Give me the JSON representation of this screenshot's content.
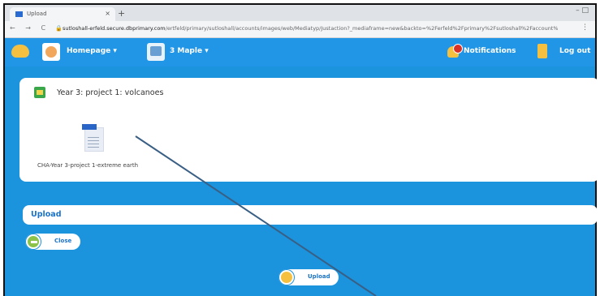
{
  "browser": {
    "tab_title": "Upload",
    "tab_close": "×",
    "new_tab": "+",
    "window_controls": "–   □",
    "nav_buttons": "← → C",
    "lock": "🔒",
    "url_host": "sutloshall-erfeld.secure.dbprimary.com",
    "url_path": "/ertfeld/primary/sutloshall/accounts/images/web/Mediatyp/Justaction?_mediaframe=new&backto=%2Ferfeld%2Fprimary%2Fsutloshall%2Faccount%2Fmesg...",
    "menu": "⋮"
  },
  "appbar": {
    "home_label": "Homepage ▾",
    "class_label": "3 Maple ▾",
    "notifications_label": "Notifications",
    "logout_label": "Log out"
  },
  "project": {
    "title": "Year 3: project 1: volcanoes",
    "file_label": "CHA-Year 3-project 1-extreme earth",
    "file_badge": "DOC"
  },
  "upload_panel": {
    "title": "Upload",
    "close_label": "Close",
    "upload_label": "Upload"
  },
  "colors": {
    "app_blue": "#1b93dd",
    "accent_yellow": "#f5c040",
    "link_blue": "#1a73c8",
    "annotation_line": "#3a5f84"
  }
}
